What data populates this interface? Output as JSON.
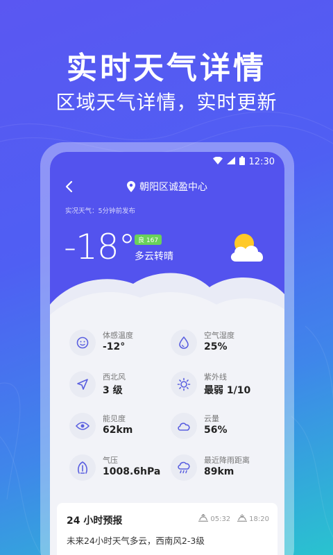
{
  "hero": {
    "title": "实时天气详情",
    "subtitle": "区域天气详情，实时更新"
  },
  "status_bar": {
    "time": "12:30",
    "icons": [
      "wifi-icon",
      "signal-icon",
      "battery-icon"
    ]
  },
  "nav": {
    "location": "朝阳区诚盈中心",
    "back_icon": "back-arrow-icon",
    "location_icon": "location-pin-icon"
  },
  "current": {
    "obs_note": "实况天气：5分钟前发布",
    "temperature": "-18°",
    "aqi_badge": "良 167",
    "condition": "多云转晴",
    "icon": "partly-cloudy-icon"
  },
  "details": [
    {
      "label": "体感温度",
      "value": "-12°",
      "icon": "smile-face-icon"
    },
    {
      "label": "空气湿度",
      "value": "25%",
      "icon": "water-drop-icon"
    },
    {
      "label": "西北风",
      "value": "3 级",
      "icon": "wind-direction-icon"
    },
    {
      "label": "紫外线",
      "value": "最弱 1/10",
      "icon": "sun-icon"
    },
    {
      "label": "能见度",
      "value": "62km",
      "icon": "eye-icon"
    },
    {
      "label": "云量",
      "value": "56%",
      "icon": "cloud-icon"
    },
    {
      "label": "气压",
      "value": "1008.6hPa",
      "icon": "pressure-gauge-icon"
    },
    {
      "label": "最近降雨距离",
      "value": "89km",
      "icon": "rain-cloud-icon"
    }
  ],
  "forecast": {
    "title": "24 小时预报",
    "sunrise": "05:32",
    "sunset": "18:20",
    "description": "未来24小时天气多云，西南风2-3级"
  },
  "colors": {
    "accent": "#5353ee",
    "aqi_good": "#6ad15a",
    "icon_color": "#5a5fe0"
  }
}
